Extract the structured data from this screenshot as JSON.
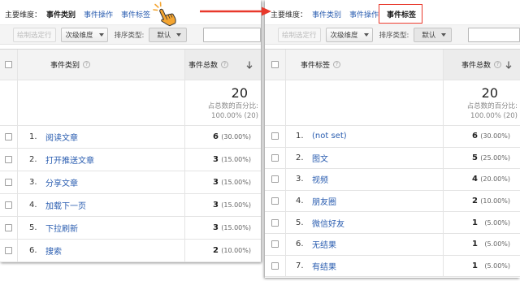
{
  "colors": {
    "link": "#2a5db0",
    "highlight_box": "#e8382b",
    "arrow": "#e8382b",
    "cursor_hand": "#f4a531"
  },
  "icons": {
    "cursor": "hand-pointer-icon",
    "transition": "arrow-right-icon",
    "help": "help-icon",
    "sort": "sort-descending-icon",
    "dropdown": "chevron-down-icon",
    "checkbox": "checkbox-icon"
  },
  "left_panel": {
    "dimension_bar": {
      "label": "主要维度：",
      "options": [
        {
          "label": "事件类别",
          "active": true
        },
        {
          "label": "事件操作",
          "active": false
        },
        {
          "label": "事件标签",
          "active": false
        }
      ]
    },
    "toolbar": {
      "plot_rows": "绘制选定行",
      "secondary_dimension": "次级维度",
      "sort_type_label": "排序类型:",
      "sort_type_value": "默认"
    },
    "table": {
      "dimension_header": "事件类别",
      "metric_header": "事件总数",
      "summary": {
        "total": "20",
        "percent_label": "占总数的百分比:",
        "percent_value": "100.00% (20)"
      },
      "rows": [
        {
          "index": "1.",
          "label": "阅读文章",
          "value": "6",
          "percent": "(30.00%)"
        },
        {
          "index": "2.",
          "label": "打开推送文章",
          "value": "3",
          "percent": "(15.00%)"
        },
        {
          "index": "3.",
          "label": "分享文章",
          "value": "3",
          "percent": "(15.00%)"
        },
        {
          "index": "4.",
          "label": "加载下一页",
          "value": "3",
          "percent": "(15.00%)"
        },
        {
          "index": "5.",
          "label": "下拉刷新",
          "value": "3",
          "percent": "(15.00%)"
        },
        {
          "index": "6.",
          "label": "搜索",
          "value": "2",
          "percent": "(10.00%)"
        }
      ]
    }
  },
  "right_panel": {
    "dimension_bar": {
      "label": "主要维度：",
      "options": [
        {
          "label": "事件类别",
          "active": false
        },
        {
          "label": "事件操作",
          "active": false
        },
        {
          "label": "事件标签",
          "active": true,
          "highlighted": true
        }
      ]
    },
    "toolbar": {
      "plot_rows": "绘制选定行",
      "secondary_dimension": "次级维度",
      "sort_type_label": "排序类型:",
      "sort_type_value": "默认"
    },
    "table": {
      "dimension_header": "事件标签",
      "metric_header": "事件总数",
      "summary": {
        "total": "20",
        "percent_label": "占总数的百分比:",
        "percent_value": "100.00% (20)"
      },
      "rows": [
        {
          "index": "1.",
          "label": "(not set)",
          "value": "6",
          "percent": "(30.00%)"
        },
        {
          "index": "2.",
          "label": "图文",
          "value": "5",
          "percent": "(25.00%)"
        },
        {
          "index": "3.",
          "label": "视频",
          "value": "4",
          "percent": "(20.00%)"
        },
        {
          "index": "4.",
          "label": "朋友圈",
          "value": "2",
          "percent": "(10.00%)"
        },
        {
          "index": "5.",
          "label": "微信好友",
          "value": "1",
          "percent": "(5.00%)"
        },
        {
          "index": "6.",
          "label": "无结果",
          "value": "1",
          "percent": "(5.00%)"
        },
        {
          "index": "7.",
          "label": "有结果",
          "value": "1",
          "percent": "(5.00%)"
        }
      ]
    }
  }
}
